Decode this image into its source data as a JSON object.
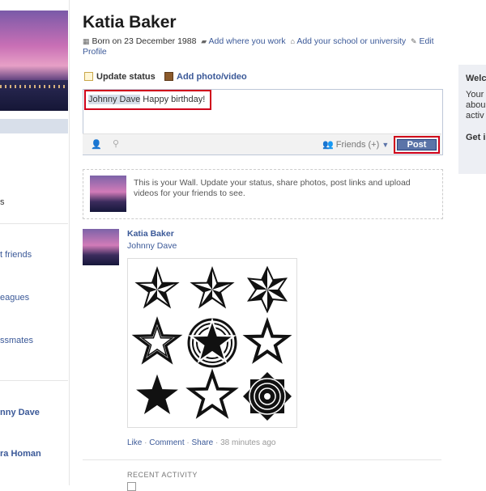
{
  "profile": {
    "name": "Katia Baker",
    "born": "Born on 23 December 1988",
    "add_work": "Add where you work",
    "add_school": "Add your school or university",
    "edit_profile_1": "Edit",
    "edit_profile_2": "Profile"
  },
  "left_nav": {
    "items": [
      "s",
      "t friends",
      "eagues",
      "ssmates"
    ],
    "friends": [
      "nny Dave",
      "ra Homan"
    ]
  },
  "composer": {
    "tab_status": "Update status",
    "tab_photo": "Add photo/video",
    "mention": "Johnny Dave",
    "text": " Happy birthday!",
    "audience": "Friends (+)",
    "post_label": "Post"
  },
  "wall": {
    "text": "This is your Wall. Update your status, share photos, post links and upload videos for your friends to see."
  },
  "post": {
    "author": "Katia Baker",
    "subtitle": "Johnny Dave",
    "like": "Like",
    "comment": "Comment",
    "share": "Share",
    "time": "38 minutes ago"
  },
  "recent_activity": "RECENT ACTIVITY",
  "right_panel": {
    "title": "Welc",
    "line1": "Your",
    "line2": "abou",
    "line3": "activ",
    "get": "Get i"
  },
  "colors": {
    "link": "#3b5998",
    "highlight": "#d0021b",
    "post_button": "#5b74a8"
  },
  "icons": [
    "calendar-icon",
    "briefcase-icon",
    "school-icon",
    "pencil-icon",
    "status-icon",
    "photo-icon",
    "tag-friend-icon",
    "location-icon",
    "friends-icon",
    "dropdown-icon"
  ]
}
